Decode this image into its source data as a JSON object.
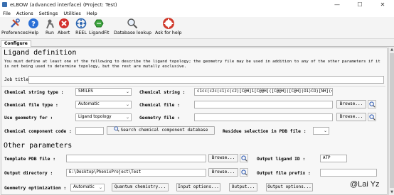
{
  "window": {
    "title": "eLBOW (advanced interface) (Project: Test)",
    "controls": [
      "—",
      "☐",
      "✕"
    ]
  },
  "menu": [
    "File",
    "Actions",
    "Settings",
    "Utilities",
    "Help"
  ],
  "toolbar": {
    "items": [
      {
        "label": "Preferences",
        "icon": "wrench-screwdriver-icon"
      },
      {
        "label": "Help",
        "icon": "help-icon"
      },
      {
        "label": "Run",
        "icon": "run-icon"
      },
      {
        "label": "Abort",
        "icon": "abort-icon"
      },
      {
        "label": "REEL",
        "icon": "reel-icon"
      },
      {
        "label": "LigandFit",
        "icon": "ligandfit-icon"
      },
      {
        "label": "Database lookup",
        "icon": "magnifier-icon"
      },
      {
        "label": "Ask for help",
        "icon": "lifebuoy-icon"
      }
    ]
  },
  "tabs": [
    "Configure"
  ],
  "ligand": {
    "heading": "Ligand definition",
    "description": "You must define at least one of the following to describe the ligand topology; the geometry file may be used in addition to any of the other parameters if it is not being used to determine topology, but the rest are mutally exclusive.",
    "job_title_label": "Job title :",
    "chem_string_type_label": "Chemical string type :",
    "chem_string_type_value": "SMILES",
    "chem_string_label": "Chemical string :",
    "chem_string_value": "c1cc(c2c(c1)c(c2)[C@H]1[C@@H]([C@@H]([C@H](O1)CO)[NH](=O)=O)O)[N]",
    "chem_file_type_label": "Chemical file type :",
    "chem_file_type_value": "Automatic",
    "chem_file_label": "Chemical file :",
    "geometry_for_label": "Use geometry for :",
    "geometry_for_value": "Ligand topology",
    "geometry_file_label": "Geometry file :",
    "browse_label": "Browse...",
    "component_code_label": "Chemical component code :",
    "search_db_label": "Search chemical component database",
    "residue_selection_label": "Residue selection in PDB file :"
  },
  "other": {
    "heading": "Other parameters",
    "template_pdb_label": "Template PDB file :",
    "browse_label": "Browse...",
    "output_ligand_id_label": "Output ligand ID :",
    "output_ligand_id_value": "ATP",
    "output_directory_label": "Output directory :",
    "output_directory_value": "E:\\Desktop\\PhenixProject\\Test",
    "output_prefix_label": "Output file prefix :",
    "geometry_opt_label": "Geometry optimization :",
    "geometry_opt_value": "Automatic",
    "quantum_btn": "Quantum chemistry...",
    "input_options_btn": "Input options...",
    "output_btn": "Output...",
    "output_options_btn": "Output options..."
  },
  "watermark": "@Lai Yz"
}
